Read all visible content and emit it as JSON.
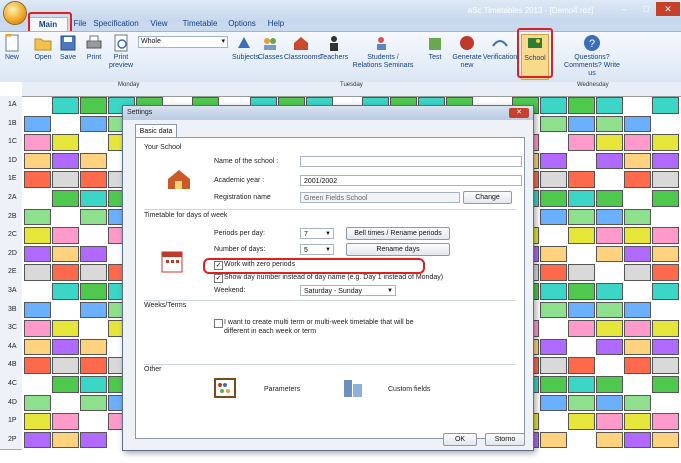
{
  "window": {
    "title": "aSc Timetables 2013 - [Demo4.roz]",
    "min": "–",
    "max": "□",
    "close": "✕"
  },
  "ribbon_tabs": [
    "Main",
    "File",
    "Specification",
    "View",
    "Timetable",
    "Options",
    "Help"
  ],
  "ribbon": {
    "new": "New",
    "open": "Open",
    "save": "Save",
    "print": "Print",
    "print_preview": "Print preview",
    "view_select": "Whole",
    "subjects": "Subjects",
    "classes": "Classes",
    "classrooms": "Classrooms",
    "teachers": "Teachers",
    "students": "Students / Relations Seminars",
    "test": "Test",
    "generate": "Generate new",
    "verification": "Verification",
    "school": "School",
    "questions": "Questions? Comments? Write us"
  },
  "grid": {
    "days": [
      "Monday",
      "Tuesday",
      "Wednesday"
    ],
    "rows": [
      "1A",
      "1B",
      "1C",
      "1D",
      "1E",
      "2A",
      "2B",
      "2C",
      "2D",
      "2E",
      "3A",
      "3B",
      "3C",
      "4A",
      "4B",
      "4C",
      "4D",
      "1P",
      "2P"
    ]
  },
  "dialog": {
    "title": "Settings",
    "close": "✕",
    "tab": "Basic data",
    "your_school": "Your School",
    "school_name_label": "Name of the school :",
    "school_name_value": "",
    "academic_year_label": "Academic year :",
    "academic_year_value": "2001/2002",
    "registration_label": "Registration name",
    "registration_value": "Green Fields School",
    "change_btn": "Change",
    "timetable_section": "Timetable for days of week",
    "periods_label": "Periods per day:",
    "periods_value": "7",
    "bell_btn": "Bell times / Rename periods",
    "days_label": "Number of days:",
    "days_value": "5",
    "rename_btn": "Rename days",
    "zero_periods": "Work with zero periods",
    "day_number": "Show day number instead of day name (e.g. Day 1 instead of Monday)",
    "weekend_label": "Weekend:",
    "weekend_value": "Saturday - Sunday",
    "weeks_section": "Weeks/Terms",
    "multi_term": "I want to create multi term or multi-week timetable that will be different in each week or term",
    "other_section": "Other",
    "parameters": "Parameters",
    "custom_fields": "Custom fields",
    "ok": "OK",
    "cancel": "Storno"
  }
}
